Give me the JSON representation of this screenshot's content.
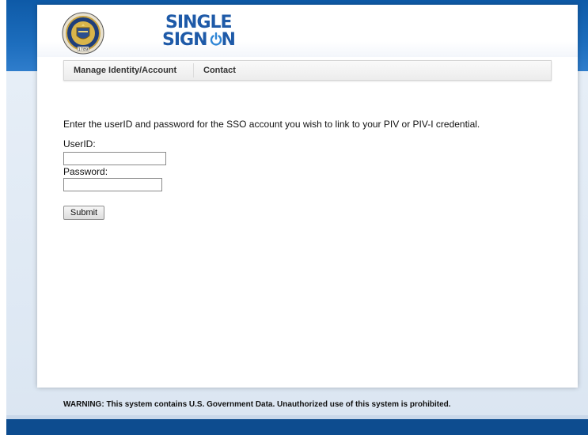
{
  "header": {
    "logo_line1": "SINGLE",
    "logo_line2_prefix": "SIGN",
    "logo_line2_suffix": "N",
    "seal_icon": "treasury-seal-icon",
    "seal_year": "1789"
  },
  "nav": {
    "items": [
      {
        "label": "Manage Identity/Account"
      },
      {
        "label": "Contact"
      }
    ]
  },
  "form": {
    "instructions": "Enter the userID and password for the SSO account you wish to link to your PIV or PIV-I credential.",
    "userid_label": "UserID:",
    "userid_value": "",
    "password_label": "Password:",
    "password_value": "",
    "submit_label": "Submit"
  },
  "footer": {
    "warning": "WARNING: This system contains U.S. Government Data. Unauthorized use of this system is prohibited."
  },
  "colors": {
    "brand_blue": "#1e5aa8",
    "top_band": "#0e5aa7",
    "bottom_band": "#0d4c8f"
  }
}
